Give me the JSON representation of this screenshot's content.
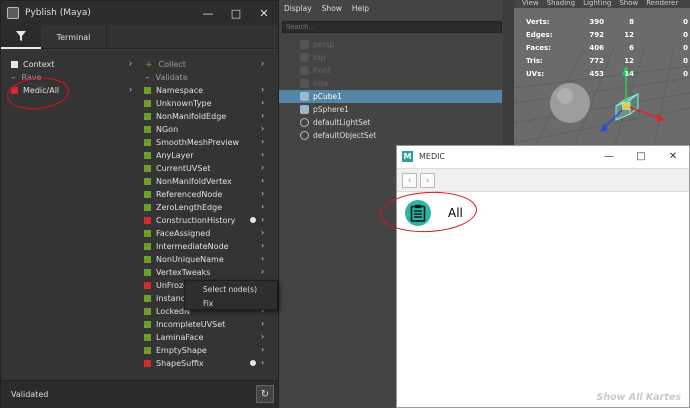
{
  "pyblish": {
    "title": "Pyblish (Maya)",
    "tabs": {
      "terminal": "Terminal"
    },
    "left_items": [
      {
        "label": "Context",
        "state": "white",
        "faded": false
      },
      {
        "label": "Rave",
        "state": "dash",
        "faded": true
      },
      {
        "label": "Medic/All",
        "state": "red",
        "faded": false
      }
    ],
    "sections": {
      "collect": "Collect",
      "validate": "Validate"
    },
    "plugins": [
      {
        "label": "Namespace",
        "state": "green",
        "marker": false
      },
      {
        "label": "UnknownType",
        "state": "green",
        "marker": false
      },
      {
        "label": "NonManifoldEdge",
        "state": "green",
        "marker": false
      },
      {
        "label": "NGon",
        "state": "green",
        "marker": false
      },
      {
        "label": "SmoothMeshPreview",
        "state": "green",
        "marker": false
      },
      {
        "label": "AnyLayer",
        "state": "green",
        "marker": false
      },
      {
        "label": "CurrentUVSet",
        "state": "green",
        "marker": false
      },
      {
        "label": "NonManifoldVertex",
        "state": "green",
        "marker": false
      },
      {
        "label": "ReferencedNode",
        "state": "green",
        "marker": false
      },
      {
        "label": "ZeroLengthEdge",
        "state": "green",
        "marker": false
      },
      {
        "label": "ConstructionHistory",
        "state": "red",
        "marker": true
      },
      {
        "label": "FaceAssigned",
        "state": "green",
        "marker": false
      },
      {
        "label": "IntermediateNode",
        "state": "green",
        "marker": false
      },
      {
        "label": "NonUniqueName",
        "state": "green",
        "marker": false
      },
      {
        "label": "VertexTweaks",
        "state": "green",
        "marker": false
      },
      {
        "label": "UnFrozen",
        "state": "red",
        "marker": false
      },
      {
        "label": "Instance",
        "state": "green",
        "marker": false
      },
      {
        "label": "LockedN",
        "state": "green",
        "marker": false
      },
      {
        "label": "IncompleteUVSet",
        "state": "green",
        "marker": false
      },
      {
        "label": "LaminaFace",
        "state": "green",
        "marker": false
      },
      {
        "label": "EmptyShape",
        "state": "green",
        "marker": false
      },
      {
        "label": "ShapeSuffix",
        "state": "red",
        "marker": true
      }
    ],
    "context_menu": [
      "Select node(s)",
      "Fix"
    ],
    "status": "Validated"
  },
  "outliner": {
    "menus": [
      "Display",
      "Show",
      "Help"
    ],
    "search_placeholder": "Search...",
    "items": [
      {
        "label": "persp",
        "type": "camera",
        "faded": true,
        "selected": false
      },
      {
        "label": "top",
        "type": "camera",
        "faded": true,
        "selected": false
      },
      {
        "label": "front",
        "type": "camera",
        "faded": true,
        "selected": false
      },
      {
        "label": "side",
        "type": "camera",
        "faded": true,
        "selected": false
      },
      {
        "label": "pCube1",
        "type": "mesh",
        "faded": false,
        "selected": true
      },
      {
        "label": "pSphere1",
        "type": "mesh",
        "faded": false,
        "selected": false
      },
      {
        "label": "defaultLightSet",
        "type": "set",
        "faded": false,
        "selected": false
      },
      {
        "label": "defaultObjectSet",
        "type": "set",
        "faded": false,
        "selected": false
      }
    ]
  },
  "viewport": {
    "menus": [
      "View",
      "Shading",
      "Lighting",
      "Show",
      "Renderer"
    ],
    "stats": [
      {
        "label": "Verts:",
        "v1": "390",
        "v2": "8",
        "v3": "0"
      },
      {
        "label": "Edges:",
        "v1": "792",
        "v2": "12",
        "v3": "0"
      },
      {
        "label": "Faces:",
        "v1": "406",
        "v2": "6",
        "v3": "0"
      },
      {
        "label": "Tris:",
        "v1": "772",
        "v2": "12",
        "v3": "0"
      },
      {
        "label": "UVs:",
        "v1": "453",
        "v2": "14",
        "v3": "0"
      }
    ]
  },
  "medic": {
    "title": "MEDIC",
    "logo_letter": "M",
    "karte_label": "All",
    "show_all": "Show All Kartes"
  },
  "colors": {
    "pass": "#6e9e2a",
    "fail": "#d22b2b",
    "selection": "#5285a6",
    "medic_accent": "#2bb5a6",
    "annotation": "#e0121a"
  }
}
